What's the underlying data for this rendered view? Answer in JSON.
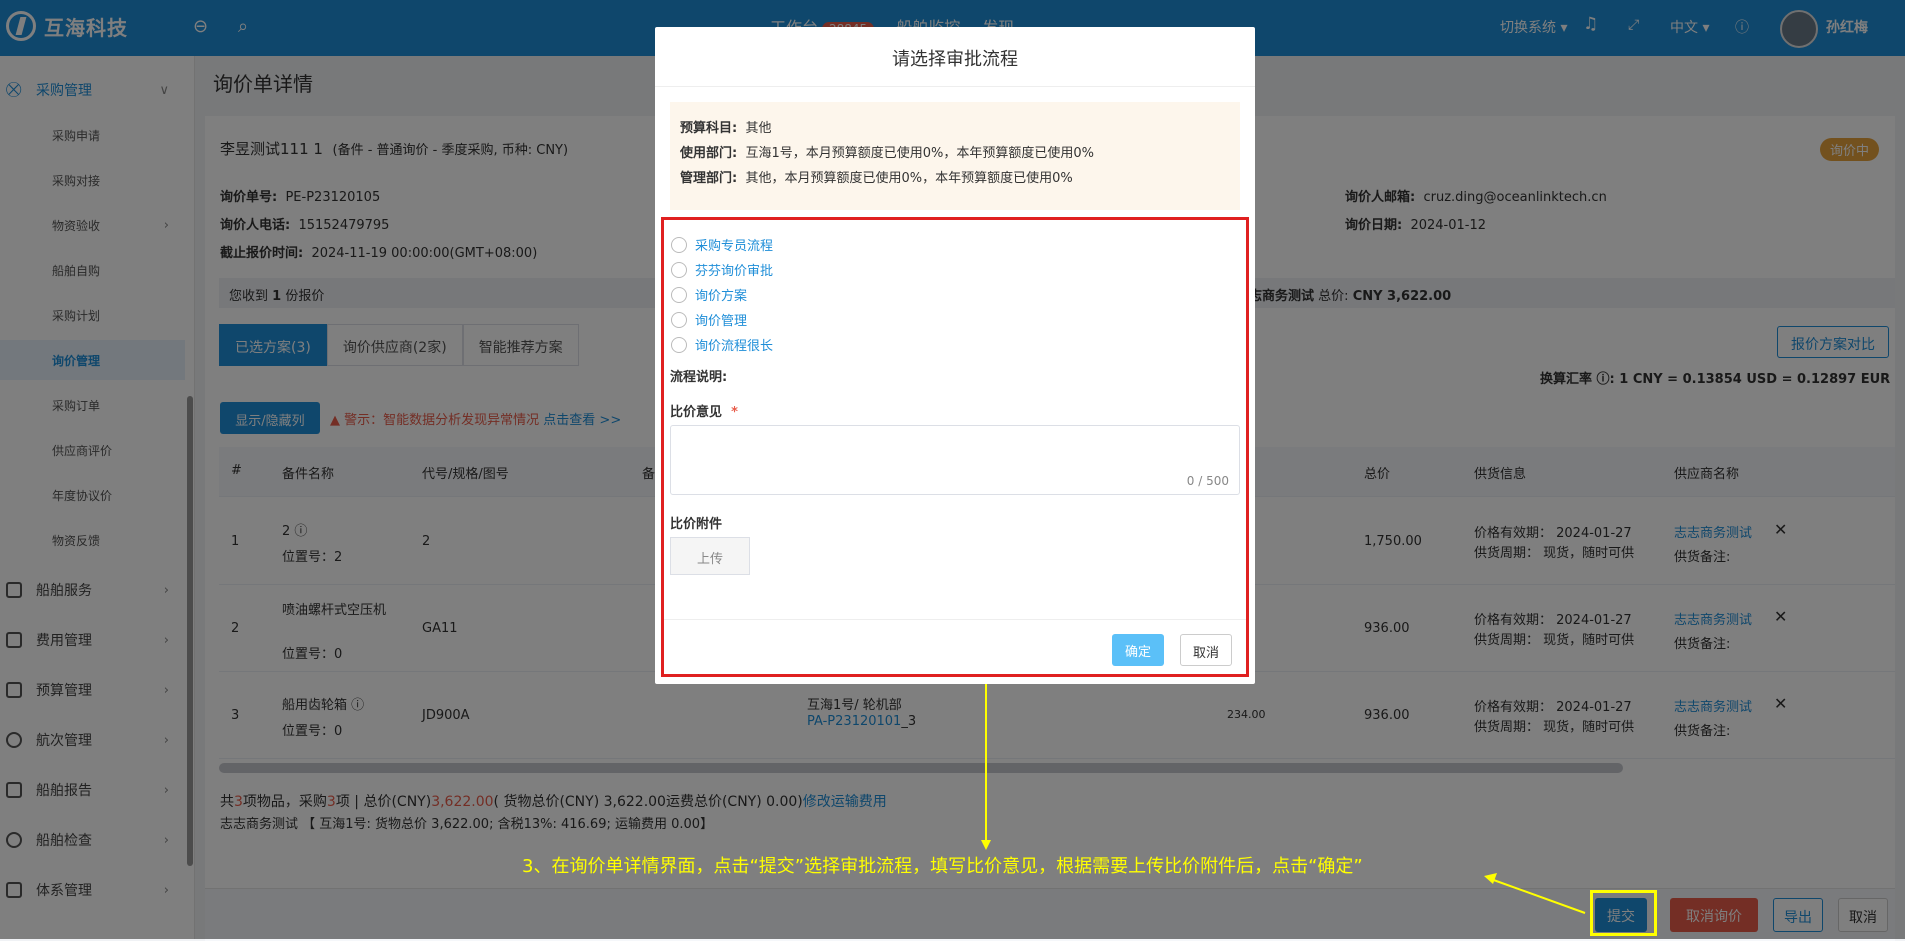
{
  "topbar": {
    "logo": "互海科技",
    "nav": [
      "工作台",
      "船舶监控",
      "发现"
    ],
    "nav_badge": "28845",
    "switch_system": "切换系统",
    "lang": "中文",
    "user": "孙红梅"
  },
  "sidebar": {
    "purchase": "采购管理",
    "sub": [
      "采购申请",
      "采购对接",
      "物资验收",
      "船舶自购",
      "采购计划",
      "询价管理",
      "采购订单",
      "供应商评价",
      "年度协议价",
      "物资反馈"
    ],
    "groups": [
      "船舶服务",
      "费用管理",
      "预算管理",
      "航次管理",
      "船舶报告",
      "船舶检查",
      "体系管理"
    ]
  },
  "page": {
    "title": "询价单详情",
    "status": "询价中"
  },
  "header": {
    "name": "李昱测试111 1",
    "name_extra": "(备件 - 普通询价 - 季度采购, 币种: CNY)",
    "no_label": "询价单号:",
    "no": "PE-P23120105",
    "phone_label": "询价人电话:",
    "phone": "15152479795",
    "deadline_label": "截止报价时间:",
    "deadline": "2024-11-19 00:00:00(GMT+08:00)",
    "email_label": "询价人邮箱:",
    "email": "cruz.ding@oceanlinktech.cn",
    "date_label": "询价日期:",
    "date": "2024-01-12"
  },
  "received": {
    "text_a": "您收到",
    "count": "1",
    "text_b": "份报价",
    "right_name": "志商务测试",
    "right_total_label": "总价:",
    "right_total": "CNY 3,622.00"
  },
  "tabs": [
    "已选方案(3)",
    "询价供应商(2家)",
    "智能推荐方案"
  ],
  "compare_btn": "报价方案对比",
  "exchange": "换算汇率 ⓘ: 1 CNY = 0.13854 USD = 0.12897 EUR",
  "toggle_btn": "显示/隐藏列",
  "warning": "警示：智能数据分析发现异常情况",
  "warning_link": "点击查看 >>",
  "table": {
    "headers": [
      "#",
      "备件名称",
      "代号/规格/图号",
      "备",
      "总价",
      "供货信息",
      "供应商名称"
    ],
    "rows": [
      {
        "idx": "1",
        "name": "2 ⓘ",
        "pos": "位置号：2",
        "code": "2",
        "total": "1,750.00",
        "valid": "价格有效期：  2024-01-27",
        "period": "供货周期：  现货，随时可供",
        "supplier": "志志商务测试",
        "remark": "供货备注:"
      },
      {
        "idx": "2",
        "name": "喷油螺杆式空压机",
        "pos": "位置号：0",
        "code": "GA11",
        "total": "936.00",
        "valid": "价格有效期：  2024-01-27",
        "period": "供货周期：  现货，随时可供",
        "supplier": "志志商务测试",
        "remark": "供货备注:"
      },
      {
        "idx": "3",
        "name": "船用齿轮箱 ⓘ",
        "pos": "位置号：0",
        "code": "JD900A",
        "ship": "互海1号/ 轮机部",
        "pa": "PA-P23120101",
        "pa_suffix": "_3",
        "price": "234.00",
        "total": "936.00",
        "valid": "价格有效期：  2024-01-27",
        "period": "供货周期：  现货，随时可供",
        "supplier": "志志商务测试",
        "remark": "供货备注:"
      }
    ]
  },
  "summary": {
    "line1_a": "共",
    "items": "3",
    "line1_b": "项物品，采购",
    "purchases": "3",
    "line1_c": "项  |   总价(CNY)",
    "total": "3,622.00",
    "line1_d": "( 货物总价(CNY)  3,622.00运费总价(CNY)  0.00)",
    "edit_freight": "修改运输费用",
    "line2": "志志商务测试 【 互海1号: 货物总价  3,622.00; 含税13%: 416.69; 运输费用  0.00】"
  },
  "footer": {
    "submit": "提交",
    "cancel_inquiry": "取消询价",
    "export": "导出",
    "cancel": "取消"
  },
  "modal": {
    "title": "请选择审批流程",
    "budget_label": "预算科目:",
    "budget": "其他",
    "use_dept_label": "使用部门:",
    "use_dept": "互海1号，本月预算额度已使用0%，本年预算额度已使用0%",
    "mgmt_dept_label": "管理部门:",
    "mgmt_dept": "其他，本月预算额度已使用0%，本年预算额度已使用0%",
    "flows": [
      "采购专员流程",
      "芬芬询价审批",
      "询价方案",
      "询价管理",
      "询价流程很长"
    ],
    "flow_desc_label": "流程说明:",
    "opinion_label": "比价意见",
    "required": "*",
    "counter": "0 / 500",
    "attach_label": "比价附件",
    "upload": "上传",
    "confirm": "确定",
    "cancel": "取消"
  },
  "annotation": "3、在询价单详情界面，点击“提交”选择审批流程，填写比价意见，根据需要上传比价附件后，点击“确定”",
  "colors": {
    "primary": "#1f8ed8",
    "annotation": "#ffff00",
    "highlight": "#e02020"
  }
}
